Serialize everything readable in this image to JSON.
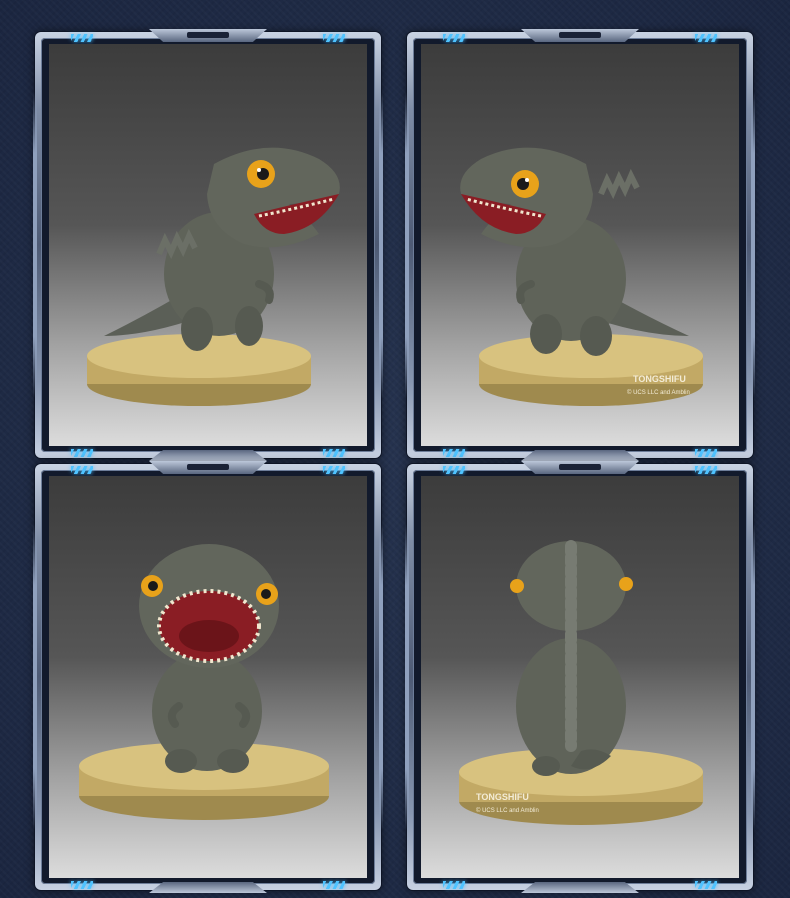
{
  "cards": [
    {
      "view": "side-right",
      "base_brand": "",
      "base_copyright": ""
    },
    {
      "view": "side-left",
      "base_brand": "TONGSHIFU",
      "base_copyright": "© UCS LLC and Amblin"
    },
    {
      "view": "front",
      "base_brand": "",
      "base_copyright": ""
    },
    {
      "view": "back",
      "base_brand": "TONGSHIFU",
      "base_copyright": "© UCS LLC and Amblin"
    }
  ],
  "colors": {
    "background": "#1f2b44",
    "frame_accent": "#4fc3ff",
    "dino_skin": "#5b5f57",
    "base_gold": "#c9b06a",
    "mouth": "#8a1d24",
    "eye": "#e8a21a"
  }
}
